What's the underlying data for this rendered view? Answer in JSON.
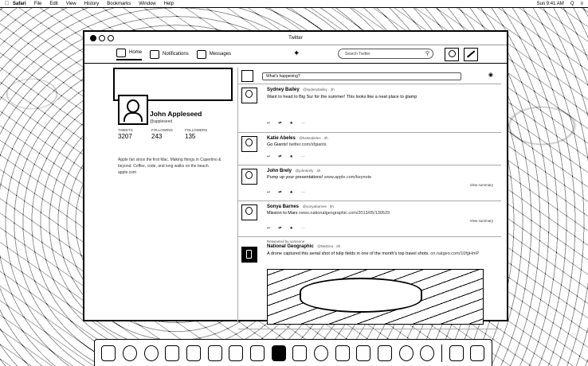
{
  "menubar": {
    "apple": "",
    "menus": [
      "Safari",
      "File",
      "Edit",
      "View",
      "History",
      "Bookmarks",
      "Window",
      "Help"
    ],
    "right_items": [
      "Sun 9:41 AM",
      "Q",
      "≡"
    ]
  },
  "window": {
    "title": "Twitter"
  },
  "nav": {
    "home": "Home",
    "notifications": "Notifications",
    "messages": "Messages",
    "search_placeholder": "Search Twitter"
  },
  "profile": {
    "name": "John Appleseed",
    "handle": "@appleseed",
    "stats": [
      {
        "label": "TWEETS",
        "value": "3207"
      },
      {
        "label": "FOLLOWING",
        "value": "243"
      },
      {
        "label": "FOLLOWERS",
        "value": "135"
      }
    ],
    "bio": "Apple fan since the first Mac. Making things in Cupertino & beyond. Coffee, code, and long walks on the beach. apple.com"
  },
  "composer": {
    "placeholder": "What's happening?"
  },
  "tweets": [
    {
      "name": "Sydney Bailey",
      "meta": "@sydneybailey · 2h",
      "text": "Want to head to Big Sur for the summer! This looks like a neat place to glamp",
      "link": "",
      "view": ""
    },
    {
      "name": "Katie Abeles",
      "meta": "@katieabeles · 3h",
      "text": "Go Giants!",
      "link": "twitter.com/sfgiants",
      "view": ""
    },
    {
      "name": "John Brely",
      "meta": "@johnbrely · 4h",
      "text": "Pump up your presentations!",
      "link": "www.apple.com/keynote",
      "view": "View summary"
    },
    {
      "name": "Sonya Barnes",
      "meta": "@sonyabarnes · 5h",
      "text": "Mission to Mars",
      "link": "news.nationalgeographic.com/2013/05/130529",
      "view": "View summary"
    },
    {
      "retweeted": "Retweeted by someone",
      "name": "National Geographic",
      "meta": "@NatGeo · 6h",
      "text": "A drone captured this aerial shot of tulip fields in one of the month's top travel shots.",
      "link": "on.natgeo.com/10fgHmP",
      "view": ""
    }
  ],
  "icons": {
    "apple": "apple-icon",
    "bird": "twitter-bird-icon",
    "search": "search-icon",
    "camera": "camera-icon",
    "compose": "compose-icon"
  }
}
